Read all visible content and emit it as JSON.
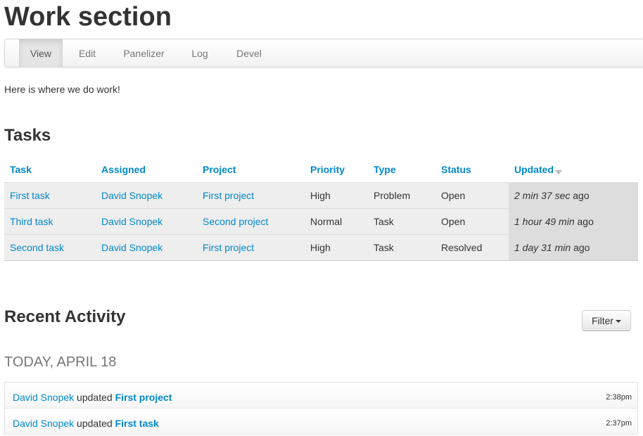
{
  "page": {
    "title": "Work section",
    "intro": "Here is where we do work!"
  },
  "tabs": [
    {
      "label": "View",
      "active": true
    },
    {
      "label": "Edit",
      "active": false
    },
    {
      "label": "Panelizer",
      "active": false
    },
    {
      "label": "Log",
      "active": false
    },
    {
      "label": "Devel",
      "active": false
    }
  ],
  "tasks": {
    "heading": "Tasks",
    "columns": [
      "Task",
      "Assigned",
      "Project",
      "Priority",
      "Type",
      "Status",
      "Updated"
    ],
    "sorted_column": "Updated",
    "rows": [
      {
        "task": "First task",
        "assigned": "David Snopek",
        "project": "First project",
        "priority": "High",
        "type": "Problem",
        "status": "Open",
        "updated_em": "2 min 37 sec",
        "updated_suffix": " ago"
      },
      {
        "task": "Third task",
        "assigned": "David Snopek",
        "project": "Second project",
        "priority": "Normal",
        "type": "Task",
        "status": "Open",
        "updated_em": "1 hour 49 min",
        "updated_suffix": " ago"
      },
      {
        "task": "Second task",
        "assigned": "David Snopek",
        "project": "First project",
        "priority": "High",
        "type": "Task",
        "status": "Resolved",
        "updated_em": "1 day 31 min",
        "updated_suffix": " ago"
      }
    ]
  },
  "activity": {
    "heading": "Recent Activity",
    "filter_label": "Filter",
    "date_heading": "Today, April 18",
    "items": [
      {
        "actor": "David Snopek",
        "verb": " updated ",
        "target": "First project",
        "time": "2:38pm"
      },
      {
        "actor": "David Snopek",
        "verb": " updated ",
        "target": "First task",
        "time": "2:37pm"
      }
    ]
  },
  "colors": {
    "link": "#0088cc",
    "row_bg": "#eeeeee",
    "sorted_col_bg": "#dddddd"
  }
}
